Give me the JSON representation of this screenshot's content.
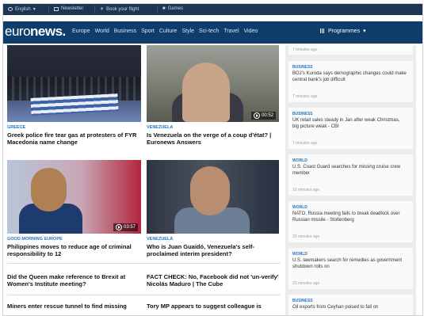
{
  "topbar": {
    "language": "English",
    "newsletter": "Newsletter",
    "book_flight": "Book your flight",
    "games": "Games"
  },
  "nav": {
    "logo_light": "euro",
    "logo_bold": "news.",
    "links": [
      "Europe",
      "World",
      "Business",
      "Sport",
      "Culture",
      "Style",
      "Sci-tech",
      "Travel",
      "Video"
    ],
    "programmes": "Programmes"
  },
  "articles": [
    {
      "category": "Greece",
      "title": "Greek police fire tear gas at protesters of FYR Macedonia name change"
    },
    {
      "category": "Venezuela",
      "title": "Is Venezuela on the verge of a coup d'état? | Euronews Answers",
      "video_duration": "00:52"
    },
    {
      "category": "Good Morning Europe",
      "title": "Philippines moves to reduce age of criminal responsibility to 12",
      "video_duration": "03:57"
    },
    {
      "category": "Venezuela",
      "title": "Who is Juan Guaidó, Venezuela's self-proclaimed interim president?"
    }
  ],
  "headlines_text": [
    "Did the Queen make reference to Brexit at Women's Institute meeting?",
    "FACT CHECK: No, Facebook did not 'un-verify' Nicolás Maduro | The Cube",
    "Miners enter rescue tunnel to find missing",
    "Tory MP appears to suggest colleague is"
  ],
  "sidebar": {
    "stub_time": "7 minutes ago",
    "items": [
      {
        "category": "Business",
        "title": "BOJ's Kuroda says demographic changes could make central bank's job difficult",
        "time": "7 minutes ago"
      },
      {
        "category": "Business",
        "title": "UK retail sales steady in Jan after weak Christmas, big picture weak - CBI",
        "time": "7 minutes ago"
      },
      {
        "category": "World",
        "title": "U.S. Coast Guard searches for missing cruise crew member",
        "time": "16 minutes ago"
      },
      {
        "category": "World",
        "title": "NATO, Russia meeting fails to break deadlock over Russian missile - Stoltenberg",
        "time": "20 minutes ago"
      },
      {
        "category": "World",
        "title": "U.S. lawmakers search for remedies as government shutdown rolls on",
        "time": "23 minutes ago"
      },
      {
        "category": "Business",
        "title": "Oil exports from Ceyhan poised to fall on",
        "time": ""
      }
    ]
  },
  "colors": {
    "nav_bg": "#0e3d6c",
    "topbar_bg": "#1c3552",
    "category": "#1f76c4"
  }
}
